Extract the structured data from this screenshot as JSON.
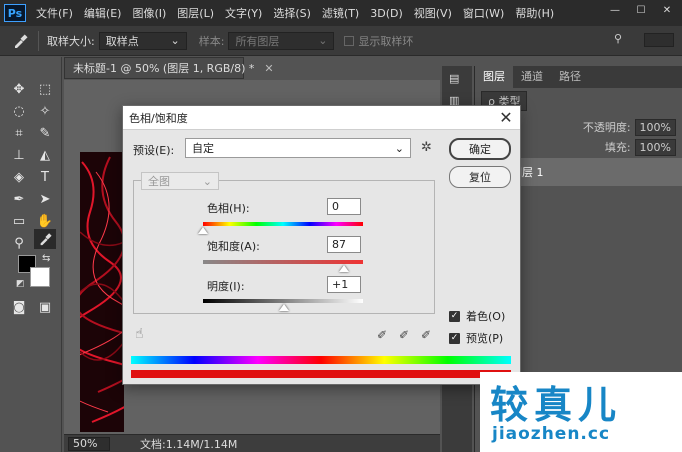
{
  "app": {
    "logo": "Ps",
    "menu": [
      "文件(F)",
      "编辑(E)",
      "图像(I)",
      "图层(L)",
      "文字(Y)",
      "选择(S)",
      "滤镜(T)",
      "3D(D)",
      "视图(V)",
      "窗口(W)",
      "帮助(H)"
    ],
    "window_buttons": [
      "—",
      "☐",
      "✕"
    ]
  },
  "options_bar": {
    "sample_size_label": "取样大小:",
    "sample_size_value": "取样点",
    "sample_label": "样本:",
    "sample_value": "所有图层",
    "show_ring_label": "显示取样环"
  },
  "document": {
    "tab_title": "未标题-1 @ 50% (图层 1, RGB/8) *",
    "zoom": "50%",
    "doc_info": "文档:1.14M/1.14M"
  },
  "layers_panel": {
    "tabs": [
      "图层",
      "通道",
      "路径"
    ],
    "filter_label": "ρ 类型",
    "opacity_label": "不透明度:",
    "opacity_value": "100%",
    "fill_label": "填充:",
    "fill_value": "100%",
    "layer_name": "图层 1"
  },
  "dialog": {
    "title": "色相/饱和度",
    "preset_label": "预设(E):",
    "preset_value": "自定",
    "channel_value": "全图",
    "ok_label": "确定",
    "reset_label": "复位",
    "hue_label": "色相(H):",
    "hue_value": "0",
    "saturation_label": "饱和度(A):",
    "saturation_value": "87",
    "lightness_label": "明度(I):",
    "lightness_value": "+1",
    "colorize_label": "着色(O)",
    "colorize_checked": true,
    "preview_label": "预览(P)",
    "preview_checked": true
  },
  "watermark": {
    "cn": "较真儿",
    "en": "jiaozhen.cc"
  }
}
